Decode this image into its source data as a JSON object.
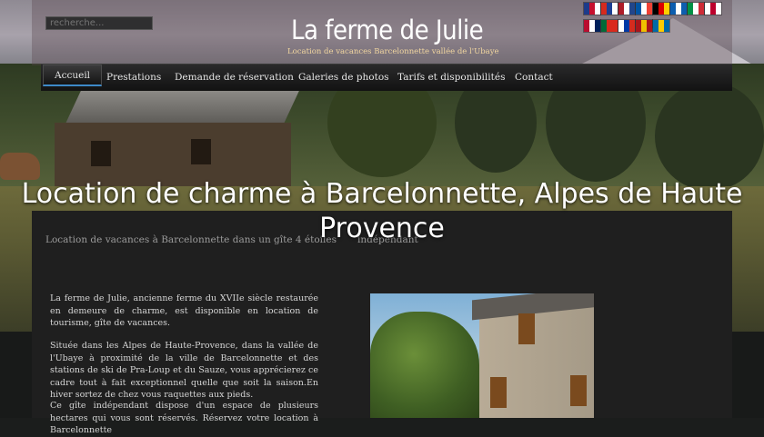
{
  "search": {
    "placeholder": "recherche..."
  },
  "site": {
    "title": "La ferme de Julie",
    "subtitle": "Location de vacances Barcelonnette vallée de l'Ubaye"
  },
  "flags": [
    {
      "name": "uk-flag-icon",
      "colors": [
        "#1d3b8a",
        "#c8102e",
        "#ffffff"
      ]
    },
    {
      "name": "taiwan-flag-icon",
      "colors": [
        "#d52b1e",
        "#1c3f94",
        "#ffffff"
      ]
    },
    {
      "name": "netherlands-flag-icon",
      "colors": [
        "#ae1c28",
        "#ffffff",
        "#21468b"
      ]
    },
    {
      "name": "france-flag-icon",
      "colors": [
        "#0055a4",
        "#ffffff",
        "#ef4135"
      ]
    },
    {
      "name": "germany-flag-icon",
      "colors": [
        "#000000",
        "#dd0000",
        "#ffce00"
      ]
    },
    {
      "name": "greece-flag-icon",
      "colors": [
        "#0d5eaf",
        "#ffffff",
        "#0d5eaf"
      ]
    },
    {
      "name": "italy-flag-icon",
      "colors": [
        "#009246",
        "#ffffff",
        "#ce2b37"
      ]
    },
    {
      "name": "japan-flag-icon",
      "colors": [
        "#ffffff",
        "#bc002d",
        "#ffffff"
      ]
    },
    {
      "name": "norway-flag-icon",
      "colors": [
        "#ba0c2f",
        "#ffffff",
        "#00205b"
      ]
    },
    {
      "name": "portugal-flag-icon",
      "colors": [
        "#046a38",
        "#da291c",
        "#da291c"
      ]
    },
    {
      "name": "russia-flag-icon",
      "colors": [
        "#ffffff",
        "#0039a6",
        "#d52b1e"
      ]
    },
    {
      "name": "spain-flag-icon",
      "colors": [
        "#aa151b",
        "#f1bf00",
        "#aa151b"
      ]
    },
    {
      "name": "sweden-flag-icon",
      "colors": [
        "#006aa7",
        "#fecc00",
        "#006aa7"
      ]
    }
  ],
  "nav": {
    "items": [
      {
        "label": "Accueil",
        "active": true
      },
      {
        "label": "Prestations"
      },
      {
        "label": "Demande de réservation"
      },
      {
        "label": "Galeries de photos"
      },
      {
        "label": "Tarifs et disponibilités"
      },
      {
        "label": "Contact"
      }
    ]
  },
  "hero": {
    "heading": "Location de charme à Barcelonnette, Alpes de Haute Provence"
  },
  "main": {
    "title": "Location de vacances à Barcelonnette dans un gîte 4 étoiles",
    "title_continued": "indépendant",
    "para1": "La ferme de Julie, ancienne ferme du XVIIe siècle restaurée en demeure de charme, est disponible en location de tourisme, gîte de vacances.",
    "para2": "Située dans les Alpes de Haute-Provence, dans la vallée de l'Ubaye à proximité de la ville de Barcelonnette et des stations de ski de Pra-Loup et du Sauze, vous apprécierez ce cadre tout à fait exceptionnel quelle que soit la saison.En hiver sortez de chez vous raquettes aux pieds.",
    "para3": "Ce gîte indépendant dispose d'un espace de plusieurs hectares qui vous sont réservés. Réservez votre location à Barcelonnette"
  },
  "colors": {
    "nav_active_underline": "#3d89c8",
    "subtitle": "#f1d6a0"
  }
}
